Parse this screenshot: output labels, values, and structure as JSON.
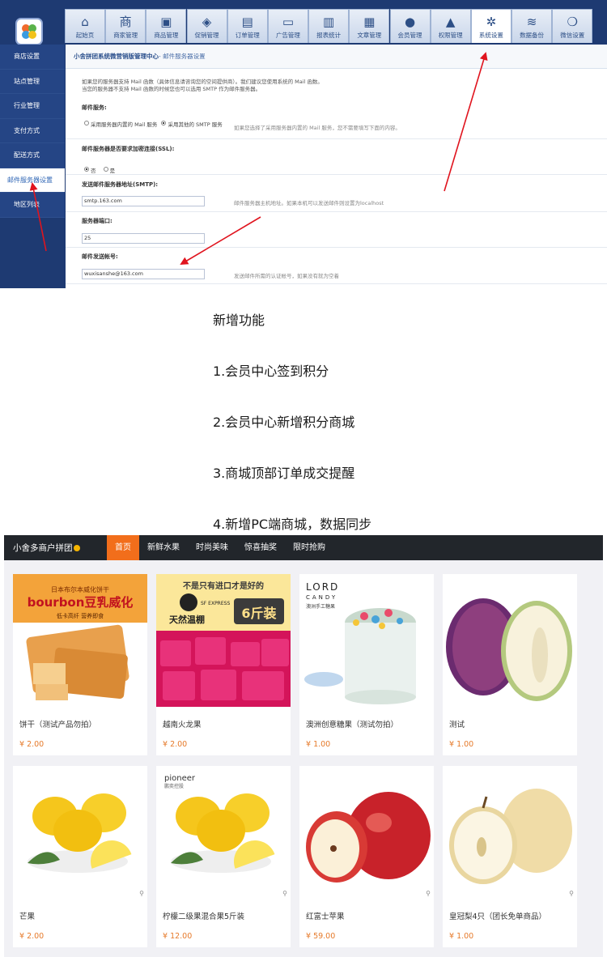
{
  "admin": {
    "breadcrumb_prefix": "小舍拼团系统微营销版管理中心",
    "breadcrumb_current": "- 邮件服务器设置",
    "sidebar": [
      {
        "label": "商店设置"
      },
      {
        "label": "站点管理"
      },
      {
        "label": "行业管理"
      },
      {
        "label": "支付方式"
      },
      {
        "label": "配送方式"
      },
      {
        "label": "邮件服务器设置",
        "active": true
      },
      {
        "label": "地区列表"
      }
    ],
    "tabs": [
      {
        "label": "起始页",
        "icon": "home-icon"
      },
      {
        "label": "商家管理",
        "icon": "shop-icon"
      },
      {
        "label": "商品管理",
        "icon": "bag-icon"
      },
      {
        "label": "促销管理",
        "icon": "tag-icon"
      },
      {
        "label": "订单管理",
        "icon": "clipboard-icon"
      },
      {
        "label": "广告管理",
        "icon": "billboard-icon"
      },
      {
        "label": "报表统计",
        "icon": "bar-chart-icon"
      },
      {
        "label": "文章管理",
        "icon": "document-icon"
      },
      {
        "label": "会员管理",
        "icon": "user-icon"
      },
      {
        "label": "权限管理",
        "icon": "lock-icon"
      },
      {
        "label": "系统设置",
        "icon": "gear-icon",
        "active": true
      },
      {
        "label": "数据备份",
        "icon": "database-icon"
      },
      {
        "label": "微信设置",
        "icon": "wechat-icon"
      }
    ],
    "note_line1": "如果您的服务器支持 Mail 函数（具体信息请咨询您的空间提供商）。我们建议您使用系统的 Mail 函数。",
    "note_line2": "当您的服务器不支持 Mail 函数的时候您也可以选用 SMTP 作为邮件服务器。",
    "mail_service_label": "邮件服务:",
    "mail_option1": "采用服务器内置的 Mail 服务",
    "mail_option2": "采用其他的 SMTP 服务",
    "mail_service_hint": "如果您选择了采用服务器内置的 Mail 服务，您不需要填写下面的内容。",
    "ssl_label": "邮件服务器是否要求加密连接(SSL):",
    "ssl_no": "否",
    "ssl_yes": "是",
    "smtp_label": "发送邮件服务器地址(SMTP):",
    "smtp_value": "smtp.163.com",
    "smtp_hint": "邮件服务器主机地址。如果本机可以发送邮件则设置为localhost",
    "port_label": "服务器端口:",
    "port_value": "25",
    "account_label": "邮件发送帐号:",
    "account_value": "wuxisanshe@163.com",
    "account_hint": "发送邮件所需的认证帐号，如果没有就为空着",
    "arrow_color": "#e0141e"
  },
  "features": [
    "新增功能",
    "1.会员中心签到积分",
    "2.会员中心新增积分商城",
    "3.商城顶部订单成交提醒",
    "4.新增PC端商城，数据同步"
  ],
  "shop": {
    "brand": "小舍多商户拼团",
    "nav": [
      {
        "label": "首页",
        "active": true
      },
      {
        "label": "新鲜水果"
      },
      {
        "label": "时尚美味"
      },
      {
        "label": "惊喜抽奖"
      },
      {
        "label": "限时抢购"
      }
    ],
    "accent": "#f26e1b",
    "products": [
      {
        "name": "饼干（测试产品勿拍）",
        "price": "¥ 2.00",
        "image": "biscuit-package",
        "img_text": [
          "日本布尔本威化饼干",
          "bourbon豆乳威化",
          "低卡高纤 营养即食"
        ]
      },
      {
        "name": "越南火龙果",
        "price": "¥ 2.00",
        "image": "dragon-fruit",
        "img_text": [
          "不是只有进口才是好的",
          "SF EXPRESS",
          "天然温棚",
          "6斤装"
        ]
      },
      {
        "name": "澳洲创意糖果（测试勿拍）",
        "price": "¥ 1.00",
        "image": "candy-jar",
        "img_text": [
          "LORD",
          "CANDY",
          "澳洲手工糖果"
        ]
      },
      {
        "name": "测试",
        "price": "¥ 1.00",
        "image": "melon"
      },
      {
        "name": "芒果",
        "price": "¥ 2.00",
        "image": "lemons"
      },
      {
        "name": "柠檬二级果混合果5斤装",
        "price": "¥ 12.00",
        "image": "lemons-pioneer",
        "img_text": [
          "pioneer",
          "鹏奕控股"
        ]
      },
      {
        "name": "红富士苹果",
        "price": "¥ 59.00",
        "image": "apples"
      },
      {
        "name": "皇冠梨4只（团长免单商品）",
        "price": "¥ 1.00",
        "image": "pears"
      }
    ]
  }
}
